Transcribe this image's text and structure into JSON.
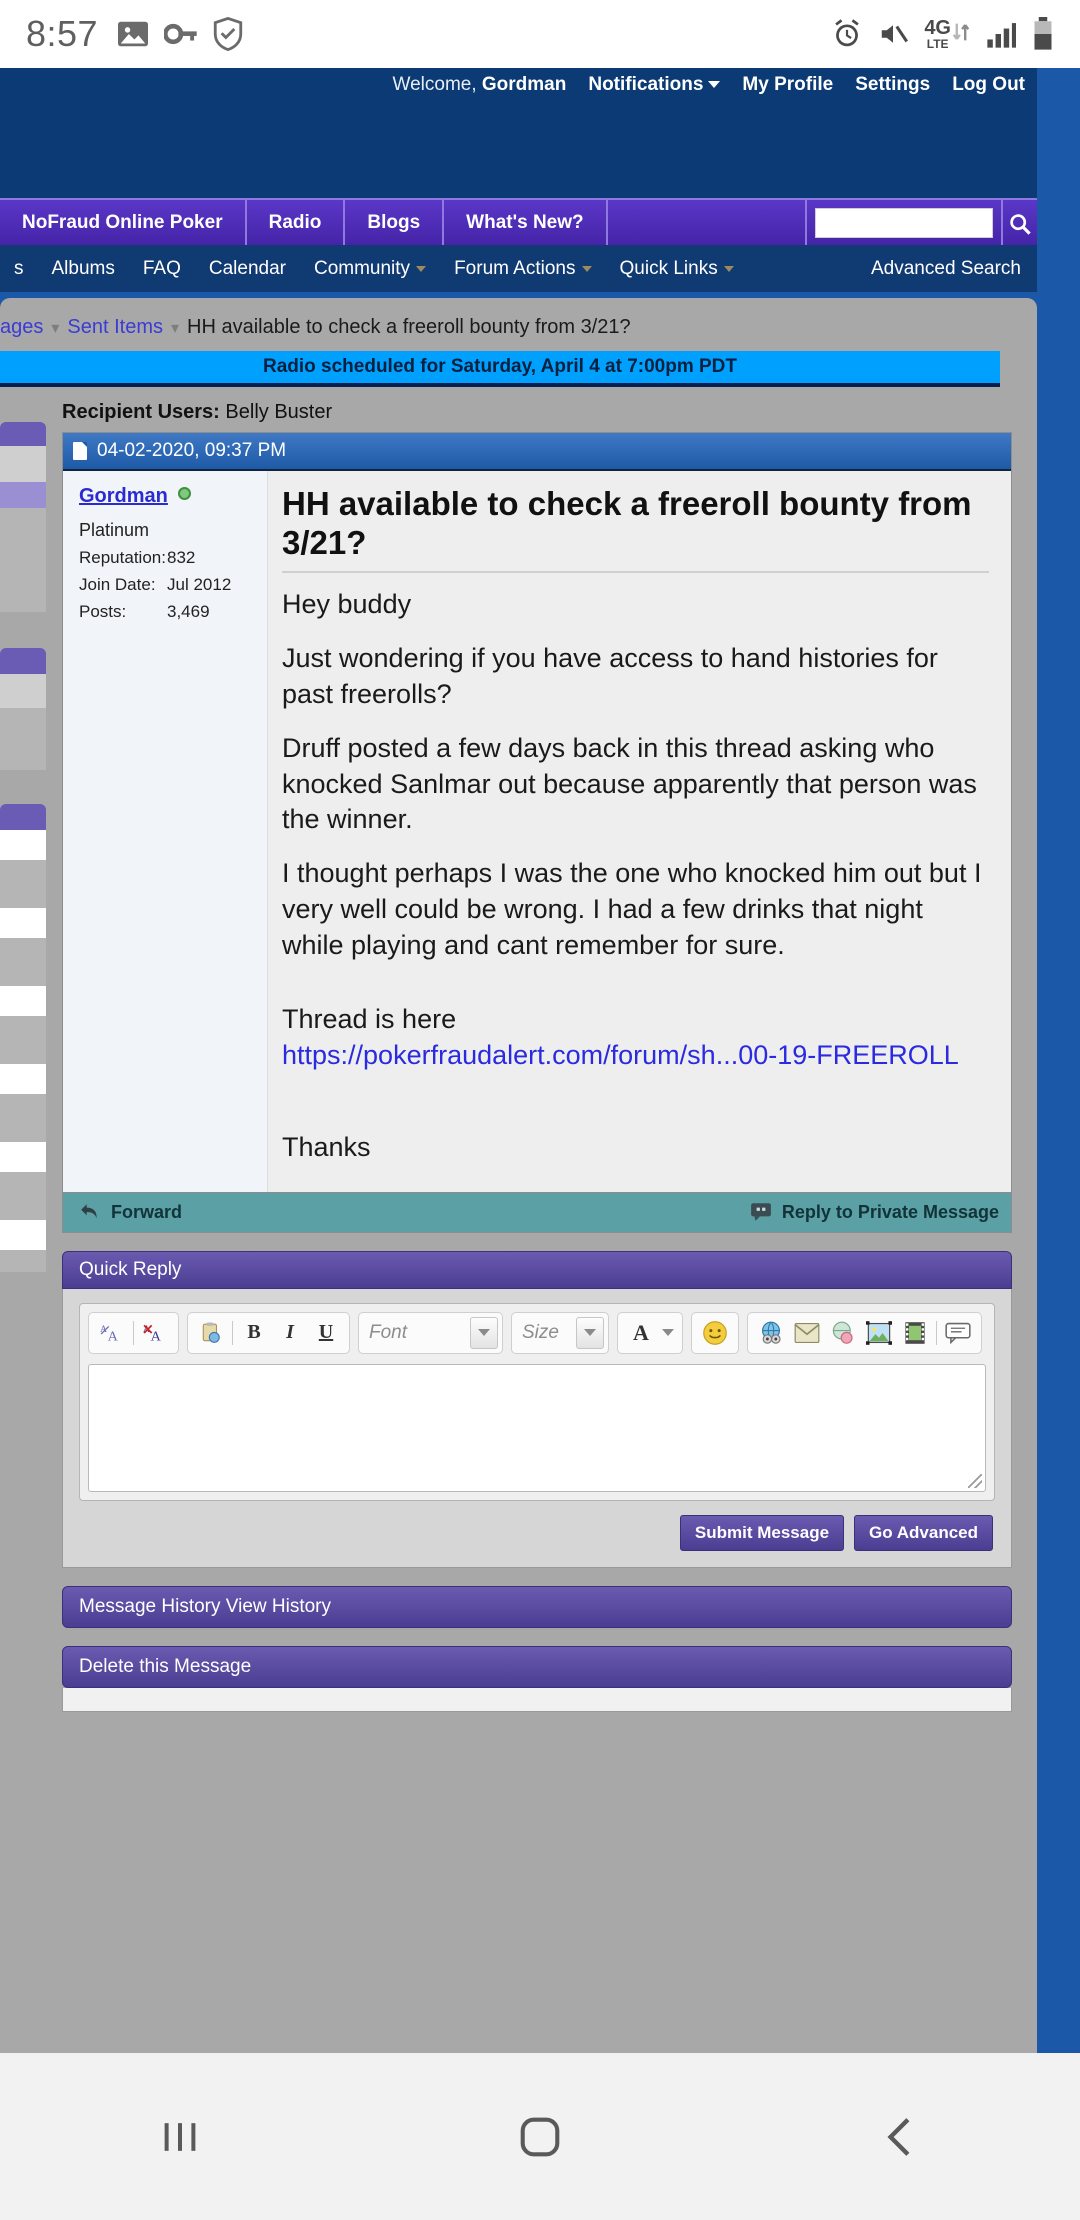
{
  "status_bar": {
    "time": "8:57",
    "left_icons": [
      "image-icon",
      "key-icon",
      "shield-check-icon"
    ],
    "right_icons": [
      "alarm-icon",
      "mute-icon",
      "4g-lte-icon",
      "signal-icon",
      "battery-icon"
    ],
    "network_label": "4G",
    "network_sub": "LTE"
  },
  "header": {
    "welcome_label": "Welcome,",
    "username": "Gordman",
    "links": [
      {
        "label": "Notifications",
        "has_caret": true
      },
      {
        "label": "My Profile",
        "has_caret": false
      },
      {
        "label": "Settings",
        "has_caret": false
      },
      {
        "label": "Log Out",
        "has_caret": false
      }
    ]
  },
  "nav": {
    "tabs": [
      {
        "label": "NoFraud Online Poker"
      },
      {
        "label": "Radio"
      },
      {
        "label": "Blogs"
      },
      {
        "label": "What's New?"
      }
    ],
    "search_value": "",
    "search_placeholder": "",
    "search_icon": "search-icon"
  },
  "subnav": {
    "items": [
      {
        "label": "s",
        "caret": false
      },
      {
        "label": "Albums",
        "caret": false
      },
      {
        "label": "FAQ",
        "caret": false
      },
      {
        "label": "Calendar",
        "caret": false
      },
      {
        "label": "Community",
        "caret": true
      },
      {
        "label": "Forum Actions",
        "caret": true
      },
      {
        "label": "Quick Links",
        "caret": true
      }
    ],
    "advanced_search": "Advanced Search"
  },
  "breadcrumb": {
    "items": [
      {
        "label": "ages",
        "link": true
      },
      {
        "label": "Sent Items",
        "link": true
      },
      {
        "label": "HH available to check a freeroll bounty from 3/21?",
        "link": false
      }
    ]
  },
  "announcement": {
    "text": "Radio scheduled for Saturday, April 4 at 7:00pm PDT"
  },
  "message": {
    "recipient_label": "Recipient Users:",
    "recipient_value": "Belly Buster",
    "timestamp": "04-02-2020, 09:37 PM",
    "doc_icon": "document-icon",
    "author": {
      "name": "Gordman",
      "online": true,
      "rank": "Platinum",
      "stats": [
        {
          "key": "Reputation:",
          "value": "832"
        },
        {
          "key": "Join Date:",
          "value": "Jul 2012"
        },
        {
          "key": "Posts:",
          "value": "3,469"
        }
      ]
    },
    "title": "HH available to check a freeroll bounty from 3/21?",
    "paragraphs": [
      "Hey buddy",
      "Just wondering if you have access to hand histories for past freerolls?",
      "Druff posted a few days back in this thread asking who knocked Sanlmar out because apparently that person was the winner.",
      "I thought perhaps I was the one who knocked him out but I very well could be wrong. I had a few drinks that night while playing and cant remember for sure."
    ],
    "thread_lead": "Thread is here",
    "thread_link": "https://pokerfraudalert.com/forum/sh...00-19-FREEROLL",
    "closing": "Thanks",
    "footer": {
      "forward_label": "Forward",
      "forward_icon": "forward-arrow-icon",
      "reply_label": "Reply to Private Message",
      "reply_icon": "speech-bubble-icon"
    }
  },
  "quick_reply": {
    "title": "Quick Reply",
    "toolbar": {
      "group1": [
        "remove-formatting-icon",
        "undo-format-icon"
      ],
      "group2": [
        "paste-icon",
        "bold-icon",
        "italic-icon",
        "underline-icon"
      ],
      "font_placeholder": "Font",
      "size_placeholder": "Size",
      "color_icon": "text-color-icon",
      "smiley_icon": "smiley-icon",
      "group3": [
        "link-icon",
        "email-icon",
        "unlink-icon",
        "image-icon",
        "video-icon",
        "quote-icon"
      ],
      "bold_label": "B",
      "italic_label": "I",
      "underline_label": "U",
      "color_label": "A"
    },
    "textarea_value": "",
    "textarea_placeholder": "",
    "submit_label": "Submit Message",
    "advanced_label": "Go Advanced"
  },
  "footer_strips": [
    {
      "label": "Message History View History"
    },
    {
      "label": "Delete this Message"
    }
  ],
  "android_nav": {
    "recent_icon": "recent-apps-icon",
    "home_icon": "home-icon",
    "back_icon": "back-icon"
  },
  "colors": {
    "header_blue": "#0b3a74",
    "nav_purple": "#4524a8",
    "announce_blue": "#00a0ff",
    "panel_grey": "#a8a8a8",
    "link_blue": "#2a2ae0",
    "footer_teal": "#5ba0a4",
    "page_blue": "#1b58a8"
  }
}
